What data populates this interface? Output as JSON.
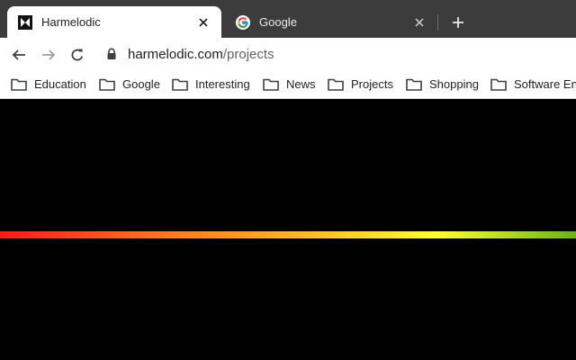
{
  "browser": {
    "tabs": [
      {
        "title": "Harmelodic",
        "active": true,
        "favicon": "harmelodic-logo-icon"
      },
      {
        "title": "Google",
        "active": false,
        "favicon": "google-g-icon"
      }
    ],
    "toolbar": {
      "url_host": "harmelodic.com",
      "url_path": "/projects"
    },
    "bookmarks": [
      {
        "label": "Education",
        "icon": "folder-icon"
      },
      {
        "label": "Google",
        "icon": "folder-icon"
      },
      {
        "label": "Interesting",
        "icon": "folder-icon"
      },
      {
        "label": "News",
        "icon": "folder-icon"
      },
      {
        "label": "Projects",
        "icon": "folder-icon"
      },
      {
        "label": "Shopping",
        "icon": "folder-icon"
      },
      {
        "label": "Software Eng",
        "icon": "folder-icon"
      }
    ]
  },
  "page": {
    "background": "#000000",
    "gradient_colors": [
      "#ff1a1a",
      "#ff7a22",
      "#ffb628",
      "#ffff33",
      "#6ab21c"
    ]
  }
}
